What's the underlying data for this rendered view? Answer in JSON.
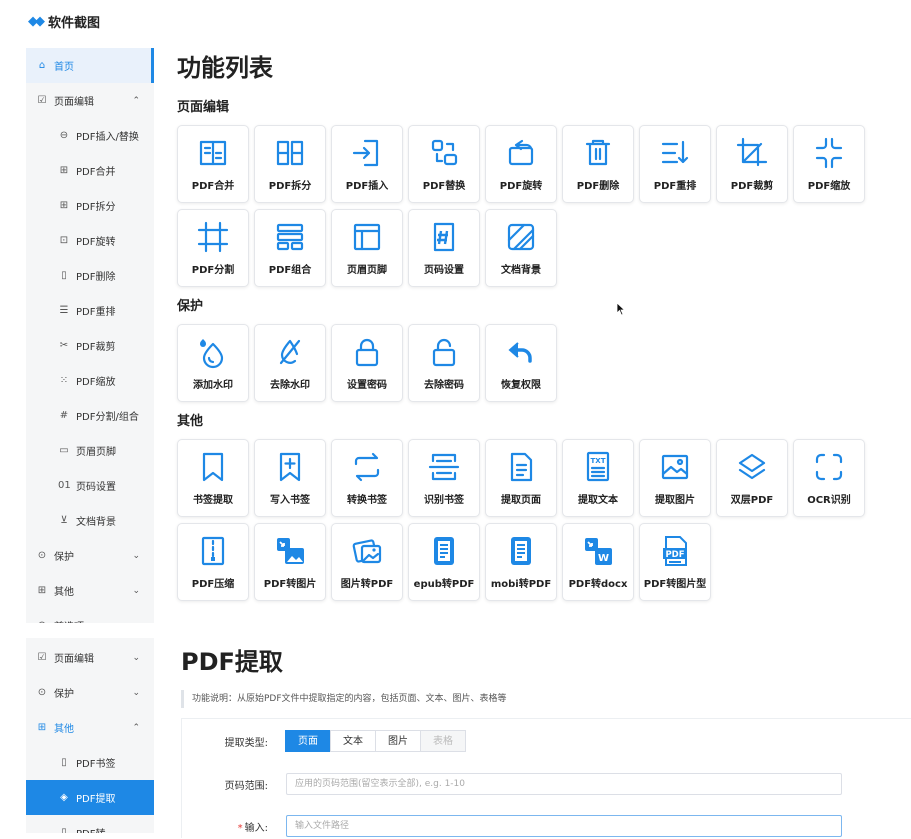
{
  "app": {
    "title": "软件截图"
  },
  "sidebar_top": [
    {
      "icon": "home-icon",
      "glyph": "⌂",
      "label": "首页",
      "active": true
    },
    {
      "icon": "edit-icon",
      "glyph": "☑",
      "label": "页面编辑",
      "chevron": "⌃"
    },
    {
      "icon": "insert-icon",
      "glyph": "⊖",
      "label": "PDF插入/替换",
      "sub": true
    },
    {
      "icon": "merge-icon",
      "glyph": "⊞",
      "label": "PDF合并",
      "sub": true
    },
    {
      "icon": "split-icon",
      "glyph": "⊞",
      "label": "PDF拆分",
      "sub": true
    },
    {
      "icon": "rotate-icon",
      "glyph": "⊡",
      "label": "PDF旋转",
      "sub": true
    },
    {
      "icon": "delete-icon",
      "glyph": "▯",
      "label": "PDF删除",
      "sub": true
    },
    {
      "icon": "reorder-icon",
      "glyph": "☰",
      "label": "PDF重排",
      "sub": true
    },
    {
      "icon": "crop-icon",
      "glyph": "✂",
      "label": "PDF裁剪",
      "sub": true
    },
    {
      "icon": "scale-icon",
      "glyph": "⁙",
      "label": "PDF缩放",
      "sub": true
    },
    {
      "icon": "hash-icon",
      "glyph": "#",
      "label": "PDF分割/组合",
      "sub": true
    },
    {
      "icon": "header-footer-icon",
      "glyph": "▭",
      "label": "页眉页脚",
      "sub": true
    },
    {
      "icon": "page-number-icon",
      "glyph": "01",
      "label": "页码设置",
      "sub": true
    },
    {
      "icon": "background-icon",
      "glyph": "⊻",
      "label": "文档背景",
      "sub": true
    },
    {
      "icon": "shield-icon",
      "glyph": "⊙",
      "label": "保护",
      "chevron": "⌄"
    },
    {
      "icon": "grid-icon",
      "glyph": "⊞",
      "label": "其他",
      "chevron": "⌄"
    },
    {
      "icon": "options-icon",
      "glyph": "⊕",
      "label": "首选项"
    }
  ],
  "sidebar_bottom": [
    {
      "icon": "edit-icon",
      "glyph": "☑",
      "label": "页面编辑",
      "chevron": "⌄"
    },
    {
      "icon": "shield-icon",
      "glyph": "⊙",
      "label": "保护",
      "chevron": "⌄"
    },
    {
      "icon": "grid-icon",
      "glyph": "⊞",
      "label": "其他",
      "chevron": "⌃",
      "blue": true
    },
    {
      "icon": "bookmark-icon",
      "glyph": "▯",
      "label": "PDF书签",
      "sub": true
    },
    {
      "icon": "extract-icon",
      "glyph": "◈",
      "label": "PDF提取",
      "sub": true,
      "solid": true
    },
    {
      "icon": "convert-icon",
      "glyph": "▯",
      "label": "PDF转",
      "sub": true
    }
  ],
  "main": {
    "title": "功能列表",
    "sections": [
      {
        "title": "页面编辑",
        "tiles": [
          {
            "label": "PDF合并",
            "icon": "merge"
          },
          {
            "label": "PDF拆分",
            "icon": "split"
          },
          {
            "label": "PDF插入",
            "icon": "insert"
          },
          {
            "label": "PDF替换",
            "icon": "replace"
          },
          {
            "label": "PDF旋转",
            "icon": "rotate"
          },
          {
            "label": "PDF删除",
            "icon": "trash"
          },
          {
            "label": "PDF重排",
            "icon": "sort"
          },
          {
            "label": "PDF裁剪",
            "icon": "crop"
          },
          {
            "label": "PDF缩放",
            "icon": "shrink"
          },
          {
            "label": "PDF分割",
            "icon": "frame"
          },
          {
            "label": "PDF组合",
            "icon": "combine"
          },
          {
            "label": "页眉页脚",
            "icon": "layout"
          },
          {
            "label": "页码设置",
            "icon": "hash"
          },
          {
            "label": "文档背景",
            "icon": "stripes"
          }
        ]
      },
      {
        "title": "保护",
        "tiles": [
          {
            "label": "添加水印",
            "icon": "drop"
          },
          {
            "label": "去除水印",
            "icon": "nodrop"
          },
          {
            "label": "设置密码",
            "icon": "lock"
          },
          {
            "label": "去除密码",
            "icon": "unlock"
          },
          {
            "label": "恢复权限",
            "icon": "undo"
          }
        ]
      },
      {
        "title": "其他",
        "tiles": [
          {
            "label": "书签提取",
            "icon": "bookmark"
          },
          {
            "label": "写入书签",
            "icon": "bookmarkplus"
          },
          {
            "label": "转换书签",
            "icon": "repeat"
          },
          {
            "label": "识别书签",
            "icon": "scan"
          },
          {
            "label": "提取页面",
            "icon": "doc"
          },
          {
            "label": "提取文本",
            "icon": "txt"
          },
          {
            "label": "提取图片",
            "icon": "image"
          },
          {
            "label": "双层PDF",
            "icon": "layers"
          },
          {
            "label": "OCR识别",
            "icon": "corners"
          },
          {
            "label": "PDF压缩",
            "icon": "zip"
          },
          {
            "label": "PDF转图片",
            "icon": "pdfimg"
          },
          {
            "label": "图片转PDF",
            "icon": "imgpdf"
          },
          {
            "label": "epub转PDF",
            "icon": "epub"
          },
          {
            "label": "mobi转PDF",
            "icon": "mobi"
          },
          {
            "label": "PDF转docx",
            "icon": "docx"
          },
          {
            "label": "PDF转图片型",
            "icon": "pdfbadge"
          }
        ]
      }
    ]
  },
  "panel": {
    "title": "PDF提取",
    "description": "功能说明：从原始PDF文件中提取指定的内容，包括页面、文本、图片、表格等",
    "type_label": "提取类型:",
    "type_options": [
      {
        "label": "页面",
        "state": "on"
      },
      {
        "label": "文本",
        "state": ""
      },
      {
        "label": "图片",
        "state": ""
      },
      {
        "label": "表格",
        "state": "dis"
      }
    ],
    "range_label": "页码范围:",
    "range_placeholder": "应用的页码范围(留空表示全部), e.g. 1-10",
    "input_label": "输入:",
    "input_placeholder": "输入文件路径"
  },
  "colors": {
    "accent": "#1e88e5",
    "required": "#e53935"
  }
}
